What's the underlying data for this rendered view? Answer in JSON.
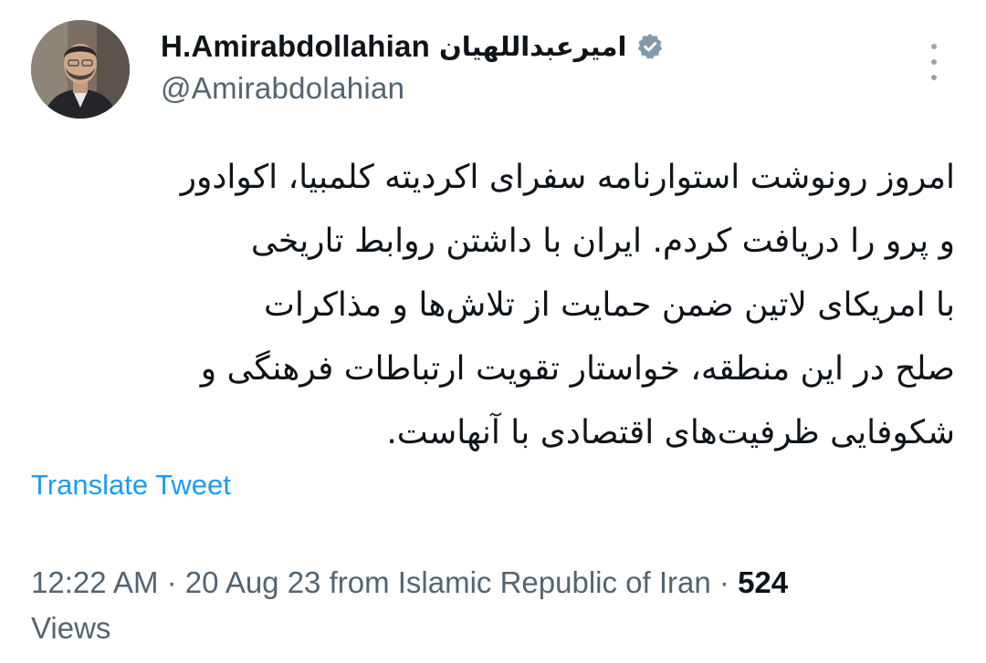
{
  "author": {
    "display_name": "H.Amirabdollahian",
    "persian_name": "امیرعبداللهیان",
    "handle": "@Amirabdolahian",
    "avatar": "profile-photo",
    "verified": "verified-badge-icon",
    "badge_color": "#829aab"
  },
  "tweet": {
    "text": "امروز رونوشت استوارنامه سفرای اکردیته کلمبیا، اکوادور\nو پرو  را دریافت کردم. ایران با داشتن روابط تاریخی\nبا امریکای لاتین  ضمن حمایت از تلاش‌ها و مذاکرات\nصلح در این منطقه، خواستار تقویت ارتباطات فرهنگی و\nشکوفایی ظرفیت‌های اقتصادی با آنهاست."
  },
  "translate_label": "Translate Tweet",
  "meta": {
    "time": "12:22 AM",
    "sep1": " · ",
    "date": "20 Aug 23",
    "source": " from Islamic Republic of Iran",
    "sep2": " · ",
    "views_count": "524",
    "views_label": "Views"
  },
  "colors": {
    "link": "#1d9bf0",
    "secondary_text": "#536471",
    "primary_text": "#0f1419"
  },
  "icons": {
    "more": "more-vertical-icon"
  }
}
